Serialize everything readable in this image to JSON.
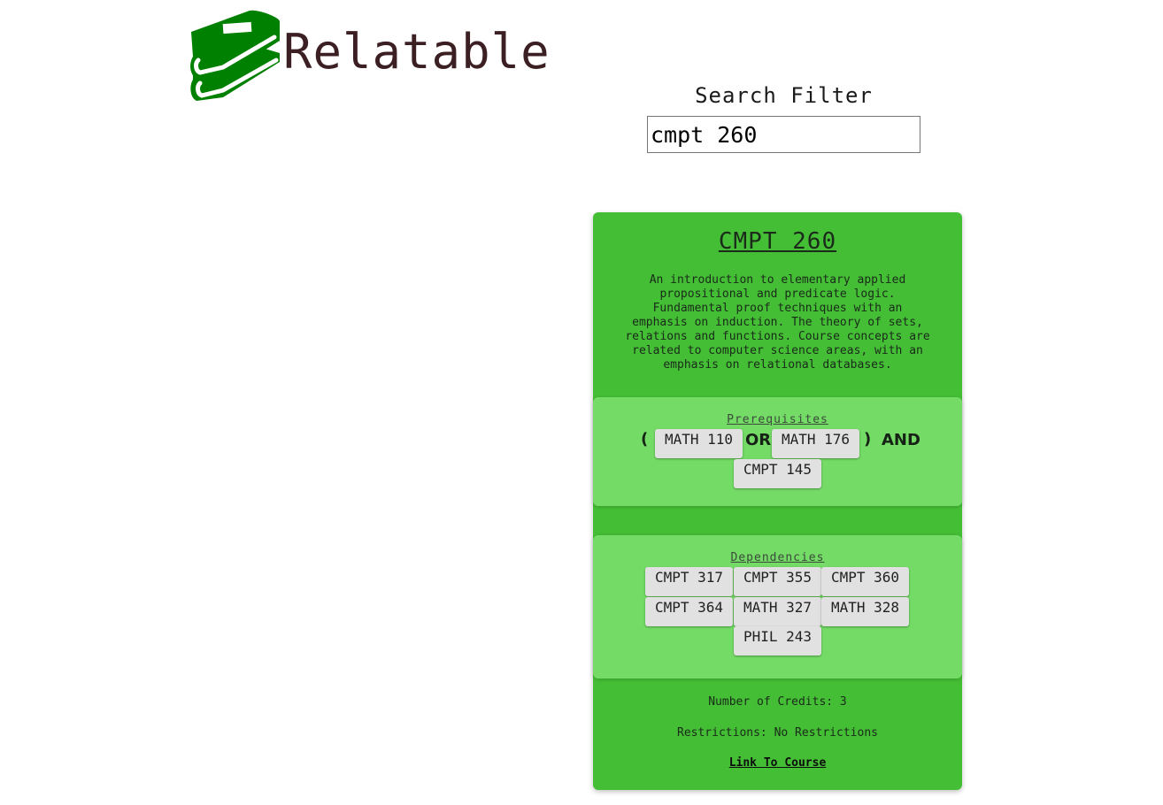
{
  "app": {
    "brand_name": "Relatable",
    "logo_icon": "books-icon",
    "brand_color": "#008000"
  },
  "search": {
    "label": "Search Filter",
    "value": "cmpt 260"
  },
  "course": {
    "code": "CMPT 260",
    "description": "An introduction to elementary applied propositional and predicate logic. Fundamental proof techniques with an emphasis on induction. The theory of sets, relations and functions. Course concepts are related to computer science areas, with an emphasis on relational databases.",
    "prerequisites": {
      "title": "Prerequisites",
      "open_paren": "(",
      "close_paren": ")",
      "or_label": "OR",
      "and_label": "AND",
      "courses": [
        "MATH 110",
        "MATH 176",
        "CMPT 145"
      ]
    },
    "dependencies": {
      "title": "Dependencies",
      "courses": [
        "CMPT 317",
        "CMPT 355",
        "CMPT 360",
        "CMPT 364",
        "MATH 327",
        "MATH 328",
        "PHIL 243"
      ]
    },
    "credits": "Number of Credits: 3",
    "restrictions": "Restrictions: No Restrictions",
    "link_label": "Link To Course"
  },
  "colors": {
    "card_bg": "#44be35",
    "panel_bg": "#74db66",
    "chip_bg": "#e1e1e1",
    "brand_text": "#3b1f23"
  }
}
